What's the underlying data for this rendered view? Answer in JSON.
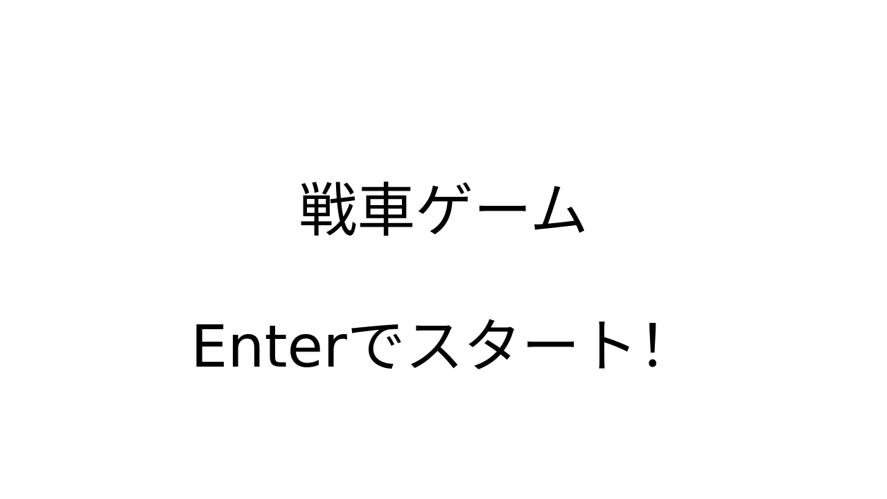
{
  "screen": {
    "title": "戦車ゲーム",
    "start_prompt": "Enterでスタート！",
    "background_color": "#ffffff",
    "text_color": "#000000"
  }
}
